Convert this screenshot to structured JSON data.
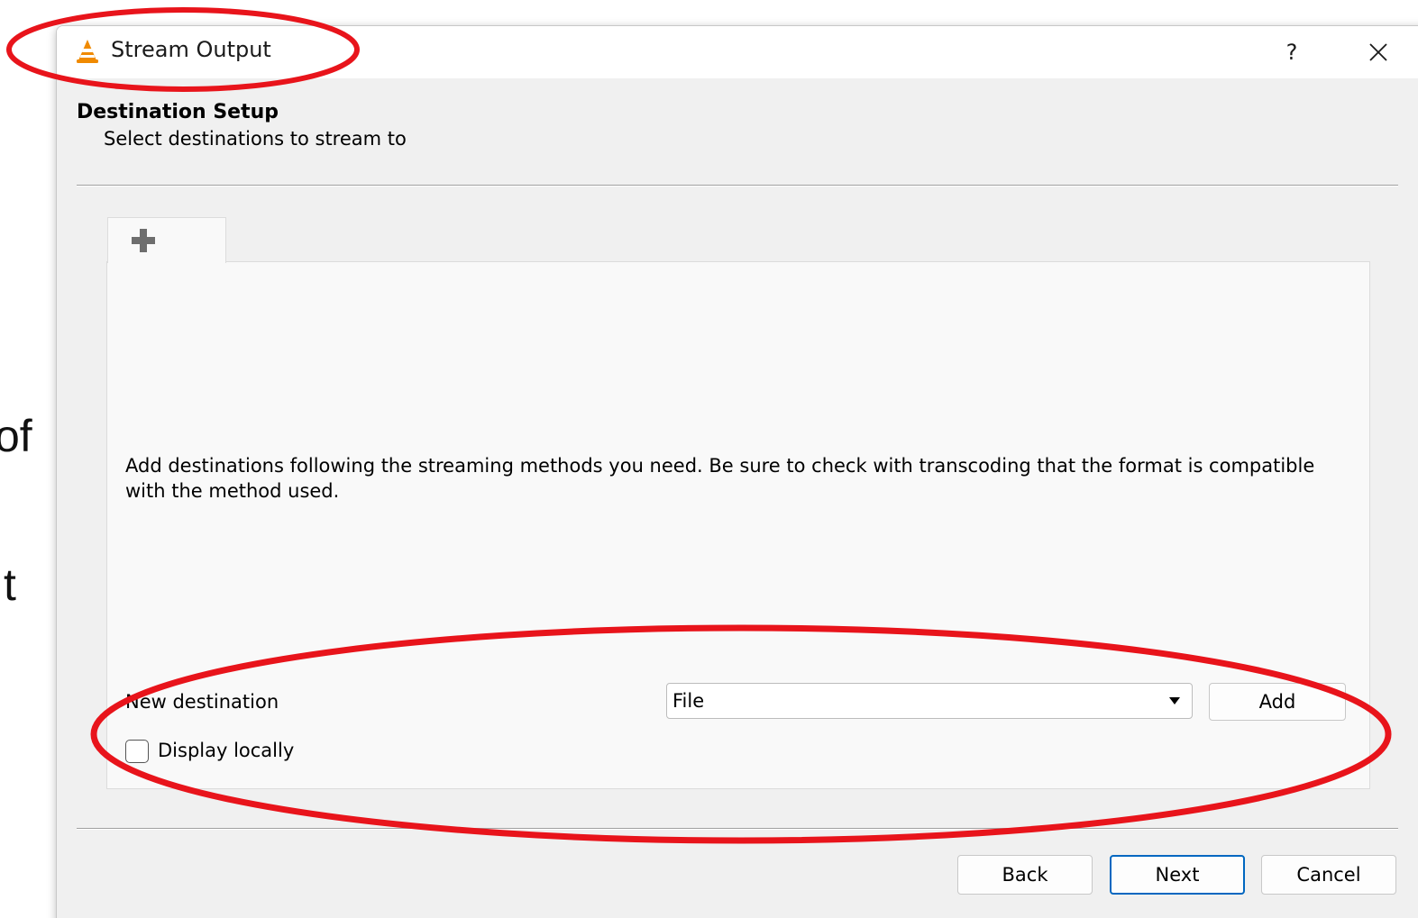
{
  "background_fragments": [
    "of",
    "t"
  ],
  "dialog": {
    "title": "Stream Output",
    "help_label": "?",
    "header": {
      "title": "Destination Setup",
      "subtitle": "Select destinations to stream to"
    },
    "tab_icon": "plus-icon",
    "info_text": "Add destinations following the streaming methods you need. Be sure to check with transcoding that the format is compatible with the method used.",
    "new_destination": {
      "label": "New destination",
      "selected": "File",
      "add_label": "Add"
    },
    "display_locally": {
      "label": "Display locally",
      "checked": false
    },
    "buttons": {
      "back": "Back",
      "next": "Next",
      "cancel": "Cancel"
    }
  },
  "colors": {
    "annotation": "#e8141b",
    "primary_button_border": "#0067c0",
    "vlc_orange": "#f08a00"
  }
}
